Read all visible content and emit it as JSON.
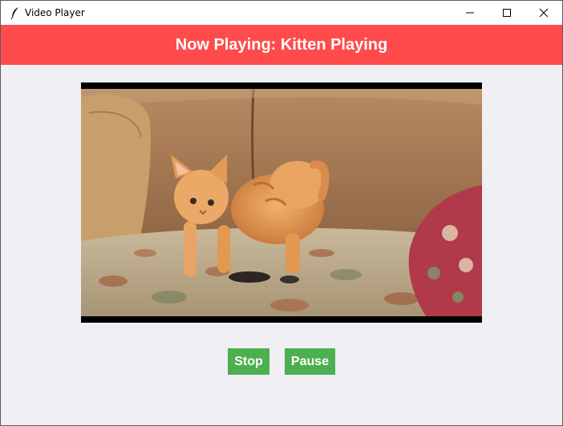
{
  "window": {
    "title": "Video Player",
    "controls": [
      "minimize-icon",
      "maximize-icon",
      "close-icon"
    ]
  },
  "header": {
    "text": "Now Playing: Kitten Playing",
    "background": "#ff4b4b"
  },
  "video": {
    "subject": "ginger-kitten-on-floral-couch"
  },
  "buttons": {
    "stop_label": "Stop",
    "pause_label": "Pause",
    "color": "#4caf50"
  }
}
